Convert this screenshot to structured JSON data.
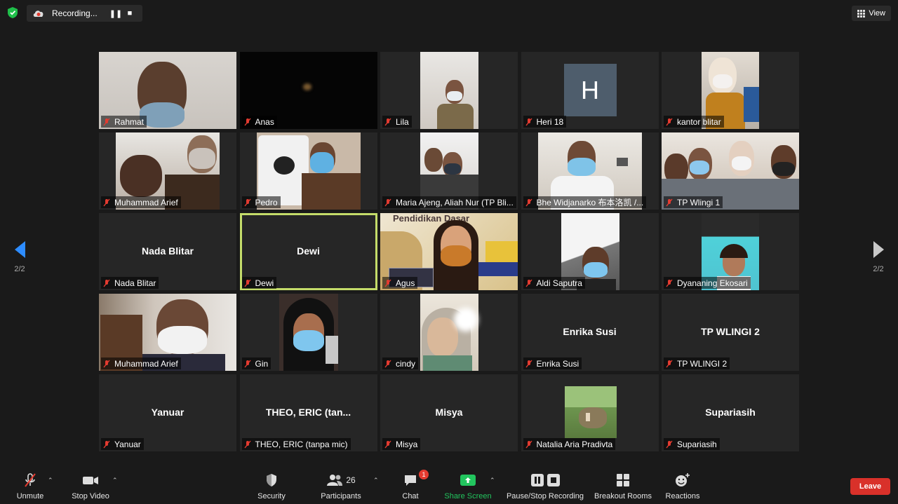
{
  "recording": {
    "label": "Recording..."
  },
  "view_button": {
    "label": "View"
  },
  "pagination": {
    "left": "2/2",
    "right": "2/2"
  },
  "tiles": [
    {
      "name": "Rahmat",
      "display": "",
      "video": true
    },
    {
      "name": "Anas",
      "display": "",
      "video": true
    },
    {
      "name": "Lila",
      "display": "",
      "video": true
    },
    {
      "name": "Heri 18",
      "display": "",
      "avatar": "H"
    },
    {
      "name": "kantor blitar",
      "display": "",
      "video": true
    },
    {
      "name": "Muhammad Arief",
      "display": "",
      "video": true
    },
    {
      "name": "Pedro",
      "display": "",
      "video": true
    },
    {
      "name": "Maria Ajeng, Aliah Nur (TP Bli...",
      "display": "",
      "video": true
    },
    {
      "name": "Bhe Widjanarko 布本洛凯 /...",
      "display": "",
      "video": true
    },
    {
      "name": "TP Wlingi 1",
      "display": "",
      "video": true
    },
    {
      "name": "Nada Blitar",
      "display": "Nada Blitar"
    },
    {
      "name": "Dewi",
      "display": "Dewi",
      "active": true
    },
    {
      "name": "Agus",
      "display": "",
      "video": true,
      "overlay_text": "Pendidikan Dasar"
    },
    {
      "name": "Aldi Saputra",
      "display": "",
      "video": true
    },
    {
      "name": "Dyananing Ekosari",
      "display": "",
      "video": true
    },
    {
      "name": "Muhammad Arief",
      "display": "",
      "video": true
    },
    {
      "name": "Gin",
      "display": "",
      "video": true
    },
    {
      "name": "cindy",
      "display": "",
      "video": true
    },
    {
      "name": "Enrika Susi",
      "display": "Enrika Susi"
    },
    {
      "name": "TP WLINGI 2",
      "display": "TP WLINGI 2"
    },
    {
      "name": "Yanuar",
      "display": "Yanuar"
    },
    {
      "name": "THEO, ERIC (tanpa mic)",
      "display": "THEO, ERIC (tan..."
    },
    {
      "name": "Misya",
      "display": "Misya"
    },
    {
      "name": "Natalia Aria Pradivta",
      "display": "",
      "video": true
    },
    {
      "name": "Supariasih",
      "display": "Supariasih"
    }
  ],
  "toolbar": {
    "unmute": "Unmute",
    "stop_video": "Stop Video",
    "security": "Security",
    "participants": "Participants",
    "participant_count": "26",
    "chat": "Chat",
    "chat_badge": "1",
    "share_screen": "Share Screen",
    "pause_stop_recording": "Pause/Stop Recording",
    "breakout_rooms": "Breakout Rooms",
    "reactions": "Reactions",
    "leave": "Leave"
  },
  "colors": {
    "share": "#22c55e",
    "leave": "#d9312a",
    "active_speaker": "#c4dc6a",
    "nav_arrow": "#2d8cff"
  }
}
